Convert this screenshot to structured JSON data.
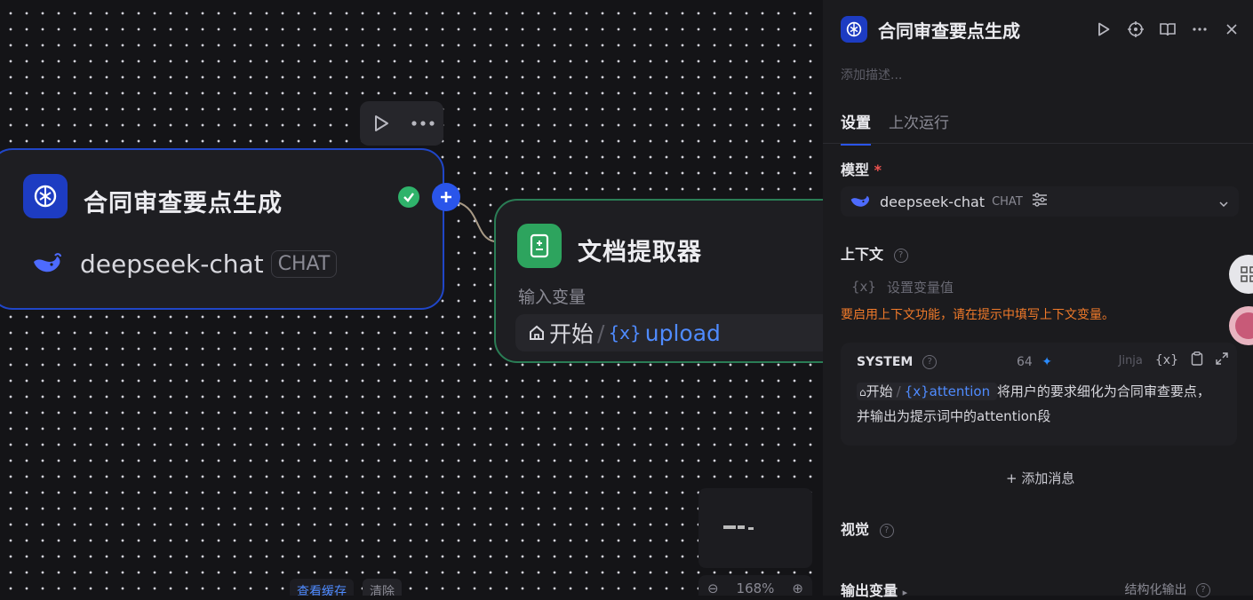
{
  "canvas": {
    "llm_node": {
      "title": "合同审查要点生成",
      "model": "deepseek-chat",
      "badge": "CHAT"
    },
    "doc_node": {
      "title": "文档提取器",
      "var_label": "输入变量",
      "var_source": "开始",
      "var_sep": "/",
      "var_name": "upload"
    },
    "zoom": "168%",
    "cache_button": "查看缓存",
    "clear_button": "清除"
  },
  "panel": {
    "title": "合同审查要点生成",
    "description_placeholder": "添加描述...",
    "tabs": [
      {
        "label": "设置"
      },
      {
        "label": "上次运行"
      }
    ],
    "model_label": "模型",
    "required_mark": "*",
    "model_name": "deepseek-chat",
    "model_badge": "CHAT",
    "context_label": "上下文",
    "context_placeholder": "设置变量值",
    "context_warning": "要启用上下文功能，请在提示中填写上下文变量。",
    "system": {
      "label": "SYSTEM",
      "count": "64",
      "jinja": "Jinja",
      "var_source": "开始",
      "var_name": "attention",
      "text_line1": "将用户的要求细化为合同审查要点，",
      "text_line2": "并输出为提示词中的attention段"
    },
    "add_message": "添加消息",
    "vision_label": "视觉",
    "output_label": "输出变量",
    "structured_output": "结构化输出"
  },
  "colors": {
    "accent": "#2a55ea",
    "llm_icon_bg": "#1d3cc2",
    "doc_icon_bg": "#2da45e",
    "warning": "#f07a2a",
    "variable": "#4f8bff"
  }
}
